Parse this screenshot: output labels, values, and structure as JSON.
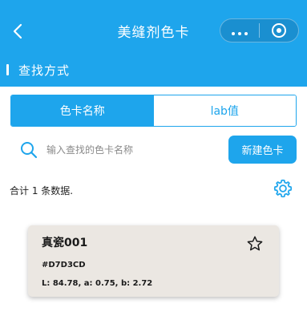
{
  "nav": {
    "title": "美缝剂色卡",
    "back_icon": "chevron-left-icon",
    "more_icon": "more-dots-icon",
    "close_icon": "target-circle-icon"
  },
  "section": {
    "title": "查找方式"
  },
  "tabs": [
    {
      "label": "色卡名称",
      "active": true
    },
    {
      "label": "lab值",
      "active": false
    }
  ],
  "search": {
    "placeholder": "输入查找的色卡名称",
    "value": "",
    "button_label": "新建色卡"
  },
  "summary": {
    "text": "合计 1 条数据."
  },
  "cards": [
    {
      "name": "真瓷001",
      "hex": "#D7D3CD",
      "lab": "L: 84.78, a: 0.75, b: 2.72",
      "favorited": false
    }
  ],
  "colors": {
    "primary": "#1ea5ec",
    "card_bg": "#ebe7e2"
  }
}
